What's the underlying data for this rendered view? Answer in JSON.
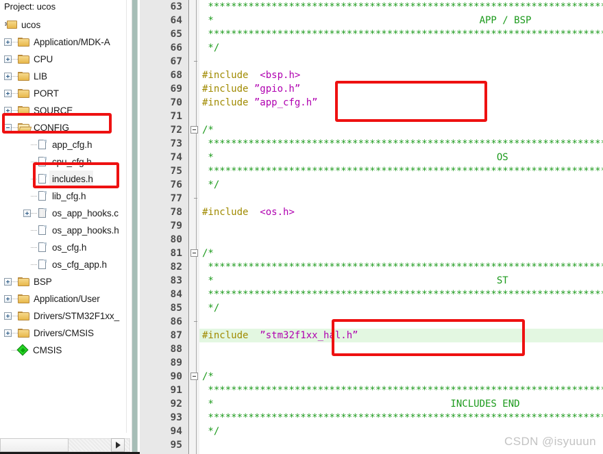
{
  "project": {
    "title": "Project: ucos",
    "root": {
      "label": "ucos",
      "icon": "project-icon"
    },
    "items": [
      {
        "label": "Application/MDK-A",
        "icon": "folder-icon",
        "expander": "plus",
        "depth": 1,
        "type": "folder"
      },
      {
        "label": "CPU",
        "icon": "folder-icon",
        "expander": "plus",
        "depth": 1,
        "type": "folder"
      },
      {
        "label": "LIB",
        "icon": "folder-icon",
        "expander": "plus",
        "depth": 1,
        "type": "folder"
      },
      {
        "label": "PORT",
        "icon": "folder-icon",
        "expander": "plus",
        "depth": 1,
        "type": "folder"
      },
      {
        "label": "SOURCE",
        "icon": "folder-icon",
        "expander": "plus",
        "depth": 1,
        "type": "folder"
      },
      {
        "label": "CONFIG",
        "icon": "folder-open-icon",
        "expander": "minus",
        "depth": 1,
        "type": "folder"
      },
      {
        "label": "app_cfg.h",
        "icon": "file-icon",
        "expander": "none",
        "depth": 2,
        "type": "file"
      },
      {
        "label": "cpu_cfg.h",
        "icon": "file-icon",
        "expander": "none",
        "depth": 2,
        "type": "file"
      },
      {
        "label": "includes.h",
        "icon": "file-icon",
        "expander": "none",
        "depth": 2,
        "type": "file",
        "selected": true
      },
      {
        "label": "lib_cfg.h",
        "icon": "file-icon",
        "expander": "none",
        "depth": 2,
        "type": "file"
      },
      {
        "label": "os_app_hooks.c",
        "icon": "source-file-icon",
        "expander": "plus",
        "depth": 2,
        "type": "file"
      },
      {
        "label": "os_app_hooks.h",
        "icon": "file-icon",
        "expander": "none",
        "depth": 2,
        "type": "file"
      },
      {
        "label": "os_cfg.h",
        "icon": "file-icon",
        "expander": "none",
        "depth": 2,
        "type": "file"
      },
      {
        "label": "os_cfg_app.h",
        "icon": "file-icon",
        "expander": "none",
        "depth": 2,
        "type": "file"
      },
      {
        "label": "BSP",
        "icon": "folder-icon",
        "expander": "plus",
        "depth": 1,
        "type": "folder"
      },
      {
        "label": "Application/User",
        "icon": "folder-icon",
        "expander": "plus",
        "depth": 1,
        "type": "folder"
      },
      {
        "label": "Drivers/STM32F1xx_",
        "icon": "folder-icon",
        "expander": "plus",
        "depth": 1,
        "type": "folder"
      },
      {
        "label": "Drivers/CMSIS",
        "icon": "folder-icon",
        "expander": "plus",
        "depth": 1,
        "type": "folder"
      },
      {
        "label": "CMSIS",
        "icon": "diamond-icon",
        "expander": "none",
        "depth": 1,
        "type": "component"
      }
    ]
  },
  "editor": {
    "lines": [
      {
        "n": "63",
        "fold": "none",
        "segments": [
          {
            "t": " ************************************************************************",
            "c": "comment"
          }
        ]
      },
      {
        "n": "64",
        "fold": "none",
        "segments": [
          {
            "t": " *                                              APP / BSP",
            "c": "comment"
          }
        ]
      },
      {
        "n": "65",
        "fold": "none",
        "segments": [
          {
            "t": " ************************************************************************",
            "c": "comment"
          }
        ]
      },
      {
        "n": "66",
        "fold": "none",
        "segments": [
          {
            "t": " */",
            "c": "comment"
          }
        ]
      },
      {
        "n": "67",
        "fold": "tick",
        "segments": []
      },
      {
        "n": "68",
        "fold": "none",
        "segments": [
          {
            "t": "#include  ",
            "c": "preproc"
          },
          {
            "t": "<bsp.h>",
            "c": "string"
          }
        ]
      },
      {
        "n": "69",
        "fold": "none",
        "segments": [
          {
            "t": "#include ",
            "c": "preproc"
          },
          {
            "t": "”gpio.h”",
            "c": "string"
          }
        ]
      },
      {
        "n": "70",
        "fold": "none",
        "segments": [
          {
            "t": "#include ",
            "c": "preproc"
          },
          {
            "t": "”app_cfg.h”",
            "c": "string"
          }
        ]
      },
      {
        "n": "71",
        "fold": "none",
        "segments": []
      },
      {
        "n": "72",
        "fold": "box",
        "segments": [
          {
            "t": "/*",
            "c": "comment"
          }
        ]
      },
      {
        "n": "73",
        "fold": "none",
        "segments": [
          {
            "t": " ************************************************************************",
            "c": "comment"
          }
        ]
      },
      {
        "n": "74",
        "fold": "none",
        "segments": [
          {
            "t": " *                                                 OS",
            "c": "comment"
          }
        ]
      },
      {
        "n": "75",
        "fold": "none",
        "segments": [
          {
            "t": " ************************************************************************",
            "c": "comment"
          }
        ]
      },
      {
        "n": "76",
        "fold": "none",
        "segments": [
          {
            "t": " */",
            "c": "comment"
          }
        ]
      },
      {
        "n": "77",
        "fold": "tick",
        "segments": []
      },
      {
        "n": "78",
        "fold": "none",
        "segments": [
          {
            "t": "#include  ",
            "c": "preproc"
          },
          {
            "t": "<os.h>",
            "c": "string"
          }
        ]
      },
      {
        "n": "79",
        "fold": "none",
        "segments": []
      },
      {
        "n": "80",
        "fold": "none",
        "segments": []
      },
      {
        "n": "81",
        "fold": "box",
        "segments": [
          {
            "t": "/*",
            "c": "comment"
          }
        ]
      },
      {
        "n": "82",
        "fold": "none",
        "segments": [
          {
            "t": " ************************************************************************",
            "c": "comment"
          }
        ]
      },
      {
        "n": "83",
        "fold": "none",
        "segments": [
          {
            "t": " *                                                 ST",
            "c": "comment"
          }
        ]
      },
      {
        "n": "84",
        "fold": "none",
        "segments": [
          {
            "t": " ************************************************************************",
            "c": "comment"
          }
        ]
      },
      {
        "n": "85",
        "fold": "none",
        "segments": [
          {
            "t": " */",
            "c": "comment"
          }
        ]
      },
      {
        "n": "86",
        "fold": "tick",
        "segments": []
      },
      {
        "n": "87",
        "fold": "none",
        "highlight": true,
        "segments": [
          {
            "t": "#include  ",
            "c": "preproc"
          },
          {
            "t": "”stm32f1xx_hal.h”",
            "c": "string"
          }
        ]
      },
      {
        "n": "88",
        "fold": "none",
        "segments": []
      },
      {
        "n": "89",
        "fold": "none",
        "segments": []
      },
      {
        "n": "90",
        "fold": "box",
        "segments": [
          {
            "t": "/*",
            "c": "comment"
          }
        ]
      },
      {
        "n": "91",
        "fold": "none",
        "segments": [
          {
            "t": " ************************************************************************",
            "c": "comment"
          }
        ]
      },
      {
        "n": "92",
        "fold": "none",
        "segments": [
          {
            "t": " *                                         INCLUDES END",
            "c": "comment"
          }
        ]
      },
      {
        "n": "93",
        "fold": "none",
        "segments": [
          {
            "t": " ************************************************************************",
            "c": "comment"
          }
        ]
      },
      {
        "n": "94",
        "fold": "none",
        "segments": [
          {
            "t": " */",
            "c": "comment"
          }
        ]
      },
      {
        "n": "95",
        "fold": "none",
        "segments": []
      }
    ]
  },
  "watermark": "CSDN @isyuuun",
  "annotations": {
    "boxes": [
      {
        "name": "config-folder-highlight"
      },
      {
        "name": "includes-file-highlight"
      },
      {
        "name": "gpio-appcfg-includes-highlight"
      },
      {
        "name": "stm32-hal-include-highlight"
      }
    ],
    "color": "#ee1111"
  },
  "colors": {
    "comment": "#1c9a1c",
    "preprocessor": "#a08a00",
    "string": "#b000b0",
    "current_line": "#e3f7e1",
    "splitter": "#a6bdb6",
    "gutter": "#e8e8e8"
  }
}
